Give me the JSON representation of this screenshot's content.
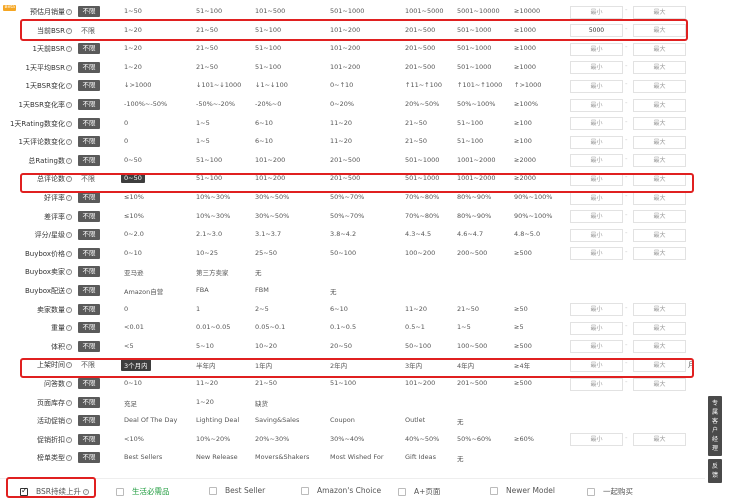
{
  "rows": [
    {
      "label": "预估月销量",
      "beta": "Beta",
      "unlimit": "不限",
      "unlimit_style": "btn",
      "options": [
        "1~50",
        "51~100",
        "101~500",
        "501~1000",
        "1001~5000",
        "5001~10000",
        "≥10000"
      ],
      "min": "",
      "max": ""
    },
    {
      "label": "当前BSR",
      "unlimit": "不限",
      "unlimit_style": "plain",
      "options": [
        "1~20",
        "21~50",
        "51~100",
        "101~200",
        "201~500",
        "501~1000",
        "≥1000"
      ],
      "min": "5000",
      "max": ""
    },
    {
      "label": "1天前BSR",
      "unlimit": "不限",
      "unlimit_style": "btn",
      "options": [
        "1~20",
        "21~50",
        "51~100",
        "101~200",
        "201~500",
        "501~1000",
        "≥1000"
      ],
      "min": "",
      "max": ""
    },
    {
      "label": "1天平均BSR",
      "unlimit": "不限",
      "unlimit_style": "btn",
      "options": [
        "1~20",
        "21~50",
        "51~100",
        "101~200",
        "201~500",
        "501~1000",
        "≥1000"
      ],
      "min": "",
      "max": ""
    },
    {
      "label": "1天BSR变化",
      "unlimit": "不限",
      "unlimit_style": "btn",
      "options": [
        "↓>1000",
        "↓101~↓1000",
        "↓1~↓100",
        "0~↑10",
        "↑11~↑100",
        "↑101~↑1000",
        "↑>1000"
      ],
      "min": "",
      "max": ""
    },
    {
      "label": "1天BSR变化率",
      "unlimit": "不限",
      "unlimit_style": "btn",
      "options": [
        "-100%~-50%",
        "-50%~-20%",
        "-20%~0",
        "0~20%",
        "20%~50%",
        "50%~100%",
        "≥100%"
      ],
      "min": "",
      "max": ""
    },
    {
      "label": "1天Rating数变化",
      "unlimit": "不限",
      "unlimit_style": "btn",
      "options": [
        "0",
        "1~5",
        "6~10",
        "11~20",
        "21~50",
        "51~100",
        "≥100"
      ],
      "min": "",
      "max": ""
    },
    {
      "label": "1天评论数变化",
      "unlimit": "不限",
      "unlimit_style": "btn",
      "options": [
        "0",
        "1~5",
        "6~10",
        "11~20",
        "21~50",
        "51~100",
        "≥100"
      ],
      "min": "",
      "max": ""
    },
    {
      "label": "总Rating数",
      "unlimit": "不限",
      "unlimit_style": "btn",
      "options": [
        "0~50",
        "51~100",
        "101~200",
        "201~500",
        "501~1000",
        "1001~2000",
        "≥2000"
      ],
      "min": "",
      "max": ""
    },
    {
      "label": "总评论数",
      "unlimit": "不限",
      "unlimit_style": "plain",
      "options": [
        "0~50",
        "51~100",
        "101~200",
        "201~500",
        "501~1000",
        "1001~2000",
        "≥2000"
      ],
      "selected": 0,
      "min": "",
      "max": ""
    },
    {
      "label": "好评率",
      "unlimit": "不限",
      "unlimit_style": "btn",
      "options": [
        "≤10%",
        "10%~30%",
        "30%~50%",
        "50%~70%",
        "70%~80%",
        "80%~90%",
        "90%~100%"
      ],
      "min": "",
      "max": ""
    },
    {
      "label": "差评率",
      "unlimit": "不限",
      "unlimit_style": "btn",
      "options": [
        "≤10%",
        "10%~30%",
        "30%~50%",
        "50%~70%",
        "70%~80%",
        "80%~90%",
        "90%~100%"
      ],
      "min": "",
      "max": ""
    },
    {
      "label": "评分/星级",
      "unlimit": "不限",
      "unlimit_style": "btn",
      "options": [
        "0~2.0",
        "2.1~3.0",
        "3.1~3.7",
        "3.8~4.2",
        "4.3~4.5",
        "4.6~4.7",
        "4.8~5.0"
      ],
      "min": "",
      "max": ""
    },
    {
      "label": "Buybox价格",
      "unlimit": "不限",
      "unlimit_style": "btn",
      "options": [
        "0~10",
        "10~25",
        "25~50",
        "50~100",
        "100~200",
        "200~500",
        "≥500"
      ],
      "min": "",
      "max": ""
    },
    {
      "label": "Buybox卖家",
      "unlimit": "不限",
      "unlimit_style": "btn",
      "options": [
        "亚马逊",
        "第三方卖家",
        "无"
      ],
      "no_inputs": true
    },
    {
      "label": "Buybox配送",
      "unlimit": "不限",
      "unlimit_style": "btn",
      "options": [
        "Amazon自营",
        "FBA",
        "FBM",
        "无"
      ],
      "no_inputs": true
    },
    {
      "label": "卖家数量",
      "unlimit": "不限",
      "unlimit_style": "btn",
      "options": [
        "0",
        "1",
        "2~5",
        "6~10",
        "11~20",
        "21~50",
        "≥50"
      ],
      "min": "",
      "max": ""
    },
    {
      "label": "重量",
      "unlimit": "不限",
      "unlimit_style": "btn",
      "options": [
        "<0.01",
        "0.01~0.05",
        "0.05~0.1",
        "0.1~0.5",
        "0.5~1",
        "1~5",
        "≥5"
      ],
      "min": "",
      "max": ""
    },
    {
      "label": "体积",
      "unlimit": "不限",
      "unlimit_style": "btn",
      "options": [
        "<5",
        "5~10",
        "10~20",
        "20~50",
        "50~100",
        "100~500",
        "≥500"
      ],
      "min": "",
      "max": ""
    },
    {
      "label": "上架时间",
      "unlimit": "不限",
      "unlimit_style": "plain",
      "options": [
        "3个月内",
        "半年内",
        "1年内",
        "2年内",
        "3年内",
        "4年内",
        "≥4年"
      ],
      "selected": 0,
      "min": "",
      "max": "",
      "unit": "月"
    },
    {
      "label": "问答数",
      "unlimit": "不限",
      "unlimit_style": "btn",
      "options": [
        "0~10",
        "11~20",
        "21~50",
        "51~100",
        "101~200",
        "201~500",
        "≥500"
      ],
      "min": "",
      "max": ""
    },
    {
      "label": "页面库存",
      "unlimit": "不限",
      "unlimit_style": "btn",
      "options": [
        "充足",
        "1~20",
        "缺货"
      ],
      "no_inputs": true
    },
    {
      "label": "活动促销",
      "unlimit": "不限",
      "unlimit_style": "btn",
      "options": [
        "Deal Of The Day",
        "Lighting Deal",
        "Saving&Sales",
        "Coupon",
        "Outlet",
        "无"
      ],
      "no_inputs": true
    },
    {
      "label": "促销折扣",
      "unlimit": "不限",
      "unlimit_style": "btn",
      "options": [
        "<10%",
        "10%~20%",
        "20%~30%",
        "30%~40%",
        "40%~50%",
        "50%~60%",
        "≥60%"
      ],
      "min": "",
      "max": ""
    },
    {
      "label": "榜单类型",
      "unlimit": "不限",
      "unlimit_style": "btn",
      "options": [
        "Best Sellers",
        "New Release",
        "Movers&Shakers",
        "Most Wished For",
        "Gift Ideas",
        "无"
      ],
      "no_inputs": true
    }
  ],
  "placeholders": {
    "min": "最小",
    "max": "最大"
  },
  "dash": "-",
  "bottom_checks": [
    {
      "label": "BSR持续上升",
      "checked": true,
      "style": "dark"
    },
    {
      "label": "生活必需品",
      "checked": false,
      "style": "green"
    },
    {
      "label": "Best Seller",
      "checked": false,
      "style": "normal"
    },
    {
      "label": "Amazon's Choice",
      "checked": false,
      "style": "normal"
    },
    {
      "label": "A+页面",
      "checked": false,
      "style": "normal"
    },
    {
      "label": "Newer Model",
      "checked": false,
      "style": "normal"
    },
    {
      "label": "一起购买",
      "checked": false,
      "style": "normal"
    }
  ],
  "side_tabs": [
    "专属客户经理",
    "反馈"
  ],
  "colors": {
    "highlight": "#e02020",
    "green": "#1a9a3a",
    "button_dark": "#5a5a5a"
  }
}
